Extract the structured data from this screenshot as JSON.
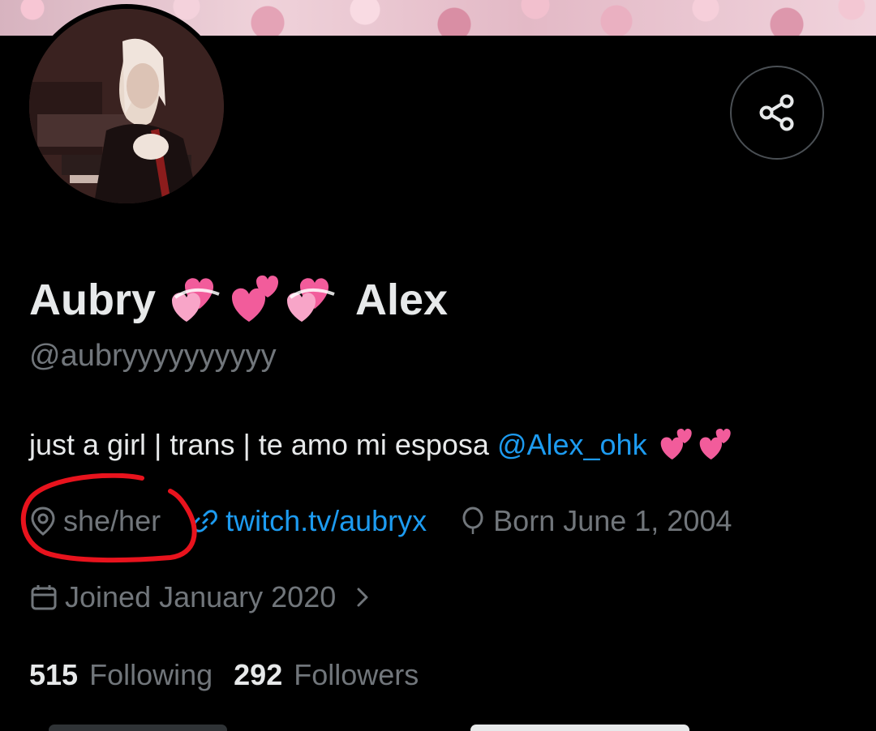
{
  "profile": {
    "display_name_first": "Aubry",
    "display_name_second": "Alex",
    "handle": "@aubryyyyyyyyyy",
    "bio_text": "just a girl | trans | te amo mi esposa",
    "bio_mention": "@Alex_ohk",
    "pronouns": "she/her",
    "website": "twitch.tv/aubryx",
    "birthday": "Born June 1, 2004",
    "joined": "Joined January 2020",
    "following_count": "515",
    "following_label": "Following",
    "followers_count": "292",
    "followers_label": "Followers"
  },
  "icons": {
    "share": "share-icon",
    "location": "location-pin-icon",
    "link": "link-icon",
    "birthday": "balloon-icon",
    "calendar": "calendar-icon",
    "chevron": "chevron-right-icon",
    "heart_emoji": "heart-emoji-icon"
  },
  "colors": {
    "background": "#000000",
    "primary_text": "#e7e9ea",
    "secondary_text": "#71767b",
    "link": "#1d9bf0",
    "annotation": "#e8131d",
    "heart_pink": "#f25c9b"
  }
}
